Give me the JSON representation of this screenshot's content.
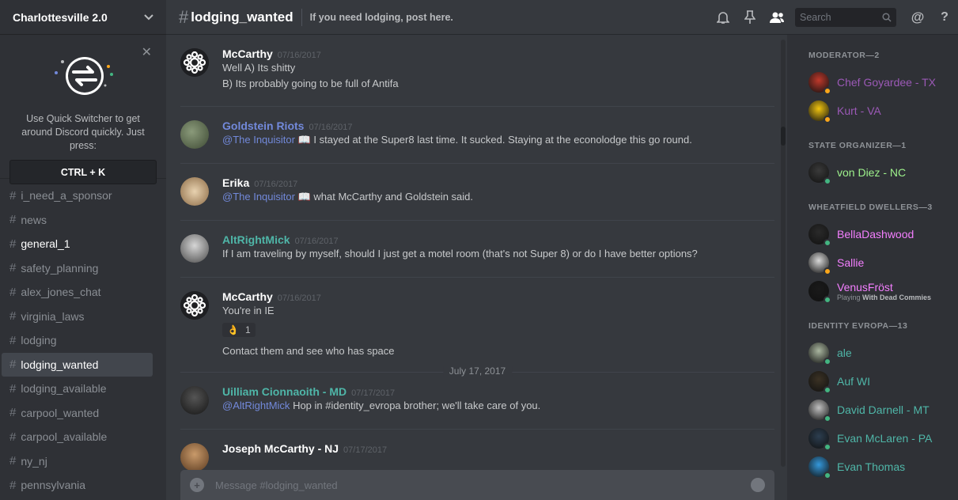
{
  "server": {
    "name": "Charlottesville 2.0"
  },
  "quick_switcher": {
    "text": "Use Quick Switcher to get around Discord quickly. Just press:",
    "shortcut": "CTRL + K"
  },
  "channels": [
    {
      "name": "i_need_a_sponsor",
      "state": "normal"
    },
    {
      "name": "news",
      "state": "normal"
    },
    {
      "name": "general_1",
      "state": "unread"
    },
    {
      "name": "safety_planning",
      "state": "normal"
    },
    {
      "name": "alex_jones_chat",
      "state": "normal"
    },
    {
      "name": "virginia_laws",
      "state": "normal"
    },
    {
      "name": "lodging",
      "state": "normal"
    },
    {
      "name": "lodging_wanted",
      "state": "active"
    },
    {
      "name": "lodging_available",
      "state": "normal"
    },
    {
      "name": "carpool_wanted",
      "state": "normal"
    },
    {
      "name": "carpool_available",
      "state": "normal"
    },
    {
      "name": "ny_nj",
      "state": "normal"
    },
    {
      "name": "pennsylvania",
      "state": "normal"
    }
  ],
  "topbar": {
    "channel": "lodging_wanted",
    "topic": "If you need lodging, post here.",
    "search_placeholder": "Search"
  },
  "messages": [
    {
      "author": "McCarthy",
      "author_color": "#ffffff",
      "time": "07/16/2017",
      "lines": [
        "Well A) Its shitty",
        "B) Its probably going to be full of Antifa"
      ]
    },
    {
      "author": "Goldstein Riots",
      "author_color": "#7289da",
      "time": "07/16/2017",
      "mention": "@The Inquisitor",
      "text": "I stayed at the Super8 last time.  It sucked.  Staying at the econolodge this go round."
    },
    {
      "author": "Erika",
      "author_color": "#ffffff",
      "time": "07/16/2017",
      "mention": "@The Inquisitor",
      "text": "what McCarthy and Goldstein said."
    },
    {
      "author": "AltRightMick",
      "author_color": "#4fb6a8",
      "time": "07/16/2017",
      "lines": [
        "If I am traveling by myself, should I just get a motel room (that's not Super 8) or do I have better options?"
      ]
    },
    {
      "author": "McCarthy",
      "author_color": "#ffffff",
      "time": "07/16/2017",
      "line1": "You're in IE",
      "reaction_count": "1",
      "line2": "Contact them and see who has space"
    },
    {
      "author": "Uilliam Cionnaoith - MD",
      "author_color": "#4fb6a8",
      "time": "07/17/2017",
      "mention": "@AltRightMick",
      "text": "Hop in #identity_evropa brother; we'll take care of you."
    },
    {
      "author": "Joseph McCarthy - NJ",
      "author_color": "#ffffff",
      "time": "07/17/2017"
    }
  ],
  "date_divider": "July 17, 2017",
  "input_placeholder": "Message #lodging_wanted",
  "member_groups": [
    {
      "role": "MODERATOR—2",
      "members": [
        {
          "name": "Chef Goyardee - TX",
          "color": "#9b59b6",
          "status": "#faa61a"
        },
        {
          "name": "Kurt - VA",
          "color": "#9b59b6",
          "status": "#faa61a"
        }
      ]
    },
    {
      "role": "STATE ORGANIZER—1",
      "members": [
        {
          "name": "von Diez - NC",
          "color": "#9ef28c",
          "status": "#43b581"
        }
      ]
    },
    {
      "role": "WHEATFIELD DWELLERS—3",
      "members": [
        {
          "name": "BellaDashwood",
          "color": "#f47fff",
          "status": "#43b581"
        },
        {
          "name": "Sallie",
          "color": "#f47fff",
          "status": "#faa61a"
        },
        {
          "name": "VenusFröst",
          "color": "#f47fff",
          "status": "#43b581",
          "sub_prefix": "Playing",
          "sub_game": "With Dead Commies"
        }
      ]
    },
    {
      "role": "IDENTITY EVROPA—13",
      "members": [
        {
          "name": "ale",
          "color": "#4fb6a8",
          "status": "#43b581"
        },
        {
          "name": "Auf WI",
          "color": "#4fb6a8",
          "status": "#43b581"
        },
        {
          "name": "David Darnell - MT",
          "color": "#4fb6a8",
          "status": "#43b581"
        },
        {
          "name": "Evan McLaren - PA",
          "color": "#4fb6a8",
          "status": "#43b581"
        },
        {
          "name": "Evan Thomas",
          "color": "#4fb6a8",
          "status": "#43b581"
        }
      ]
    }
  ]
}
